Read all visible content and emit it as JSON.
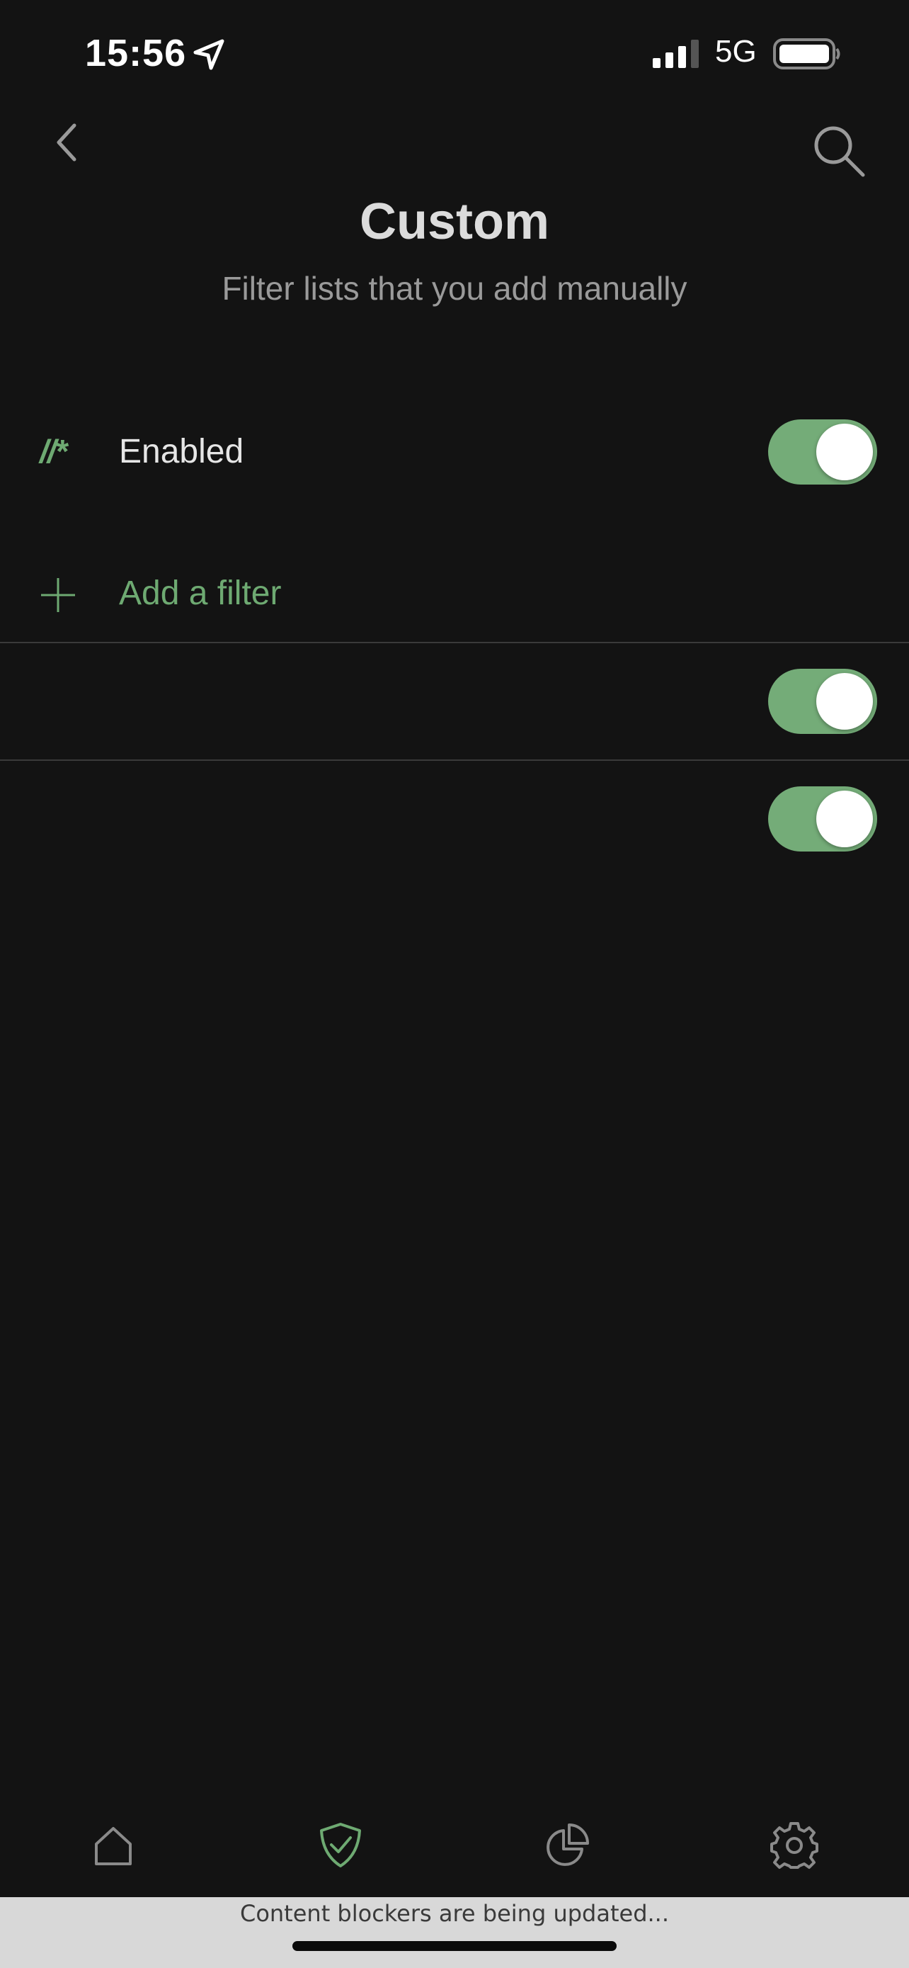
{
  "status_bar": {
    "time": "15:56",
    "network": "5G",
    "icons": [
      "location-arrow-icon",
      "signal-icon",
      "battery-icon"
    ]
  },
  "header": {
    "title": "Custom",
    "subtitle": "Filter lists that you add manually",
    "icons": [
      "back-chevron-icon",
      "search-icon"
    ]
  },
  "enabled_row": {
    "icon_text": "//*",
    "label": "Enabled",
    "toggle_on": true
  },
  "add_filter": {
    "label": "Add a filter",
    "icon": "plus-icon"
  },
  "filters": [
    {
      "enabled": true
    },
    {
      "enabled": true
    }
  ],
  "tab_bar": {
    "tabs": [
      {
        "name": "home",
        "icon": "home-icon",
        "active": false
      },
      {
        "name": "protection",
        "icon": "shield-check-icon",
        "active": true
      },
      {
        "name": "statistics",
        "icon": "pie-chart-icon",
        "active": false
      },
      {
        "name": "settings",
        "icon": "gear-icon",
        "active": false
      }
    ]
  },
  "banner": {
    "text": "Content blockers are being updated..."
  },
  "colors": {
    "background": "#131313",
    "accent": "#6eaa72",
    "toggle_on": "#74ac78",
    "banner": "#d8d8d8"
  }
}
